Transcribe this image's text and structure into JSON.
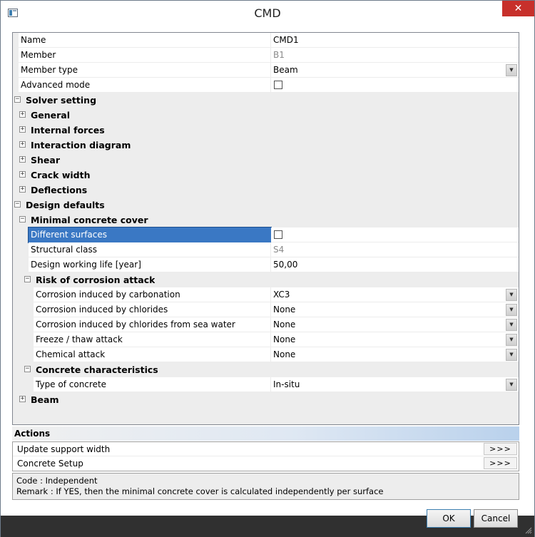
{
  "window": {
    "title": "CMD",
    "close_glyph": "✕",
    "app_icon": "dialog-app-icon"
  },
  "properties": {
    "name_label": "Name",
    "name_value": "CMD1",
    "member_label": "Member",
    "member_value": "B1",
    "member_type_label": "Member type",
    "member_type_value": "Beam",
    "advanced_mode_label": "Advanced mode",
    "advanced_mode_checked": false
  },
  "solver_setting": {
    "label": "Solver setting",
    "children": [
      "General",
      "Internal forces",
      "Interaction diagram",
      "Shear",
      "Crack width",
      "Deflections"
    ]
  },
  "design_defaults": {
    "label": "Design defaults",
    "minimal_cover": {
      "label": "Minimal concrete cover",
      "different_surfaces_label": "Different surfaces",
      "different_surfaces_checked": false,
      "structural_class_label": "Structural class",
      "structural_class_value": "S4",
      "design_life_label": "Design working life [year]",
      "design_life_value": "50,00"
    },
    "risk": {
      "label": "Risk of corrosion attack",
      "items": [
        {
          "label": "Corrosion induced by carbonation",
          "value": "XC3"
        },
        {
          "label": "Corrosion induced by chlorides",
          "value": "None"
        },
        {
          "label": "Corrosion induced by chlorides from sea water",
          "value": "None"
        },
        {
          "label": "Freeze / thaw attack",
          "value": "None"
        },
        {
          "label": "Chemical attack",
          "value": "None"
        }
      ]
    },
    "concrete": {
      "label": "Concrete characteristics",
      "type_label": "Type of concrete",
      "type_value": "In-situ"
    }
  },
  "beam": {
    "label": "Beam"
  },
  "actions": {
    "header": "Actions",
    "items": [
      {
        "label": "Update support width",
        "button": ">>>"
      },
      {
        "label": "Concrete Setup",
        "button": ">>>"
      }
    ]
  },
  "description": {
    "code": "Code : Independent",
    "remark": "Remark : If YES, then the minimal concrete cover is calculated independently per surface"
  },
  "buttons": {
    "ok": "OK",
    "cancel": "Cancel"
  },
  "glyphs": {
    "expand": "+",
    "collapse": "−",
    "dropdown": "▼"
  },
  "colors": {
    "close_red": "#c7302b",
    "selection_blue": "#3a78c4",
    "grid_bg": "#ededed"
  }
}
